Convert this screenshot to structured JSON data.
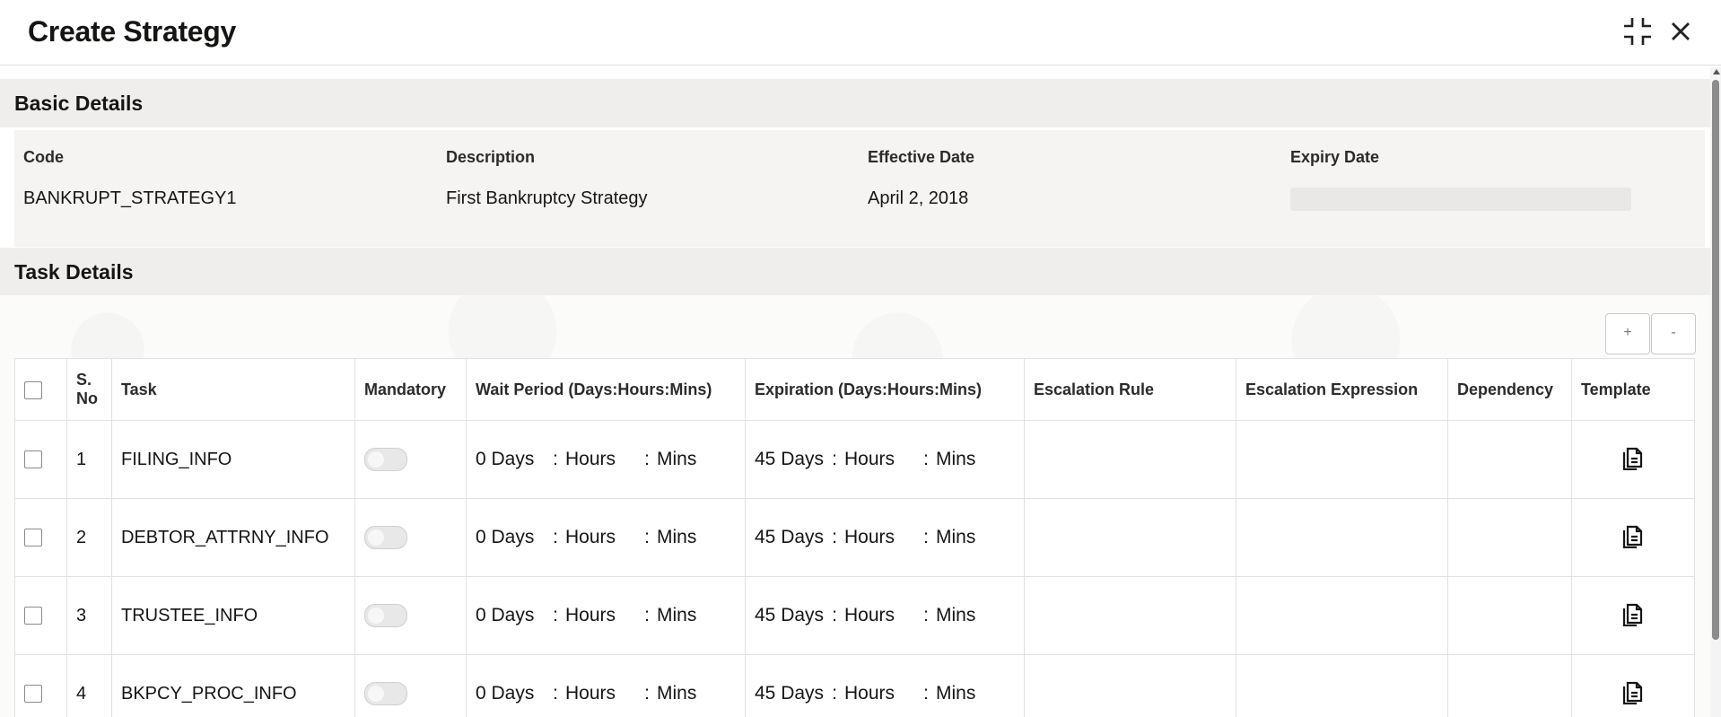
{
  "dialog": {
    "title": "Create Strategy"
  },
  "basic_details": {
    "heading": "Basic Details",
    "fields": [
      {
        "label": "Code",
        "value": "BANKRUPT_STRATEGY1"
      },
      {
        "label": "Description",
        "value": "First Bankruptcy Strategy"
      },
      {
        "label": "Effective Date",
        "value": "April 2, 2018"
      },
      {
        "label": "Expiry Date",
        "value": ""
      }
    ]
  },
  "task_details": {
    "heading": "Task Details",
    "add_label": "+",
    "remove_label": "-",
    "columns": [
      "S. No",
      "Task",
      "Mandatory",
      "Wait Period (Days:Hours:Mins)",
      "Expiration (Days:Hours:Mins)",
      "Escalation Rule",
      "Escalation Expression",
      "Dependency",
      "Template"
    ],
    "rows": [
      {
        "sno": "1",
        "task": "FILING_INFO",
        "wait": {
          "days": "0 Days",
          "hours": "Hours",
          "mins": "Mins"
        },
        "exp": {
          "days": "45 Days",
          "hours": "Hours",
          "mins": "Mins"
        }
      },
      {
        "sno": "2",
        "task": "DEBTOR_ATTRNY_INFO",
        "wait": {
          "days": "0 Days",
          "hours": "Hours",
          "mins": "Mins"
        },
        "exp": {
          "days": "45 Days",
          "hours": "Hours",
          "mins": "Mins"
        }
      },
      {
        "sno": "3",
        "task": "TRUSTEE_INFO",
        "wait": {
          "days": "0 Days",
          "hours": "Hours",
          "mins": "Mins"
        },
        "exp": {
          "days": "45 Days",
          "hours": "Hours",
          "mins": "Mins"
        }
      },
      {
        "sno": "4",
        "task": "BKPCY_PROC_INFO",
        "wait": {
          "days": "0 Days",
          "hours": "Hours",
          "mins": "Mins"
        },
        "exp": {
          "days": "45 Days",
          "hours": "Hours",
          "mins": "Mins"
        }
      }
    ],
    "separator": ":"
  },
  "icons": {
    "minimize": "collapse-icon",
    "close": "close-icon",
    "template": "document-icon"
  }
}
